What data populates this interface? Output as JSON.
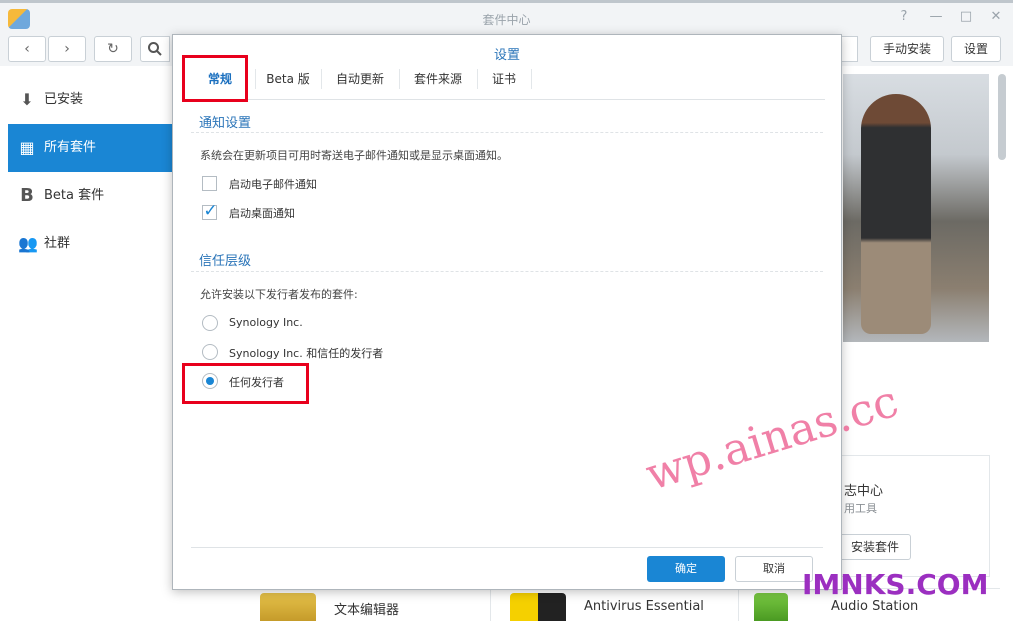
{
  "window": {
    "title": "套件中心",
    "controls": {
      "help": "?",
      "minimize": "—",
      "maximize": "□",
      "close": "✕"
    }
  },
  "toolbar": {
    "back": "‹",
    "forward": "›",
    "refresh": "↻",
    "manual_install": "手动安装",
    "settings": "设置"
  },
  "sidebar": {
    "items": [
      {
        "label": "已安装",
        "icon": "download-icon"
      },
      {
        "label": "所有套件",
        "icon": "grid-icon"
      },
      {
        "label": "Beta 套件",
        "icon": "beta-icon"
      },
      {
        "label": "社群",
        "icon": "community-icon"
      }
    ]
  },
  "featured_card": {
    "title": "志中心",
    "subtitle": "用工具",
    "install_label": "安装套件"
  },
  "bottom_apps": [
    {
      "name": "文本编辑器"
    },
    {
      "name": "Antivirus Essential"
    },
    {
      "name": "Audio Station"
    }
  ],
  "dialog": {
    "title": "设置",
    "tabs": [
      {
        "label": "常规"
      },
      {
        "label": "Beta 版"
      },
      {
        "label": "自动更新"
      },
      {
        "label": "套件来源"
      },
      {
        "label": "证书"
      }
    ],
    "notify": {
      "heading": "通知设置",
      "description": "系统会在更新项目可用时寄送电子邮件通知或是显示桌面通知。",
      "email_label": "启动电子邮件通知",
      "email_checked": false,
      "desktop_label": "启动桌面通知",
      "desktop_checked": true
    },
    "trust": {
      "heading": "信任层级",
      "description": "允许安装以下发行者发布的套件:",
      "options": [
        {
          "label": "Synology Inc.",
          "selected": false
        },
        {
          "label": "Synology Inc. 和信任的发行者",
          "selected": false
        },
        {
          "label": "任何发行者",
          "selected": true
        }
      ]
    },
    "ok_label": "确定",
    "cancel_label": "取消"
  },
  "watermarks": {
    "text1": "wp.ainas.cc",
    "text2": "IMNKS.COM"
  },
  "colors": {
    "accent": "#1a86d4",
    "highlight_box": "#e8001c"
  }
}
